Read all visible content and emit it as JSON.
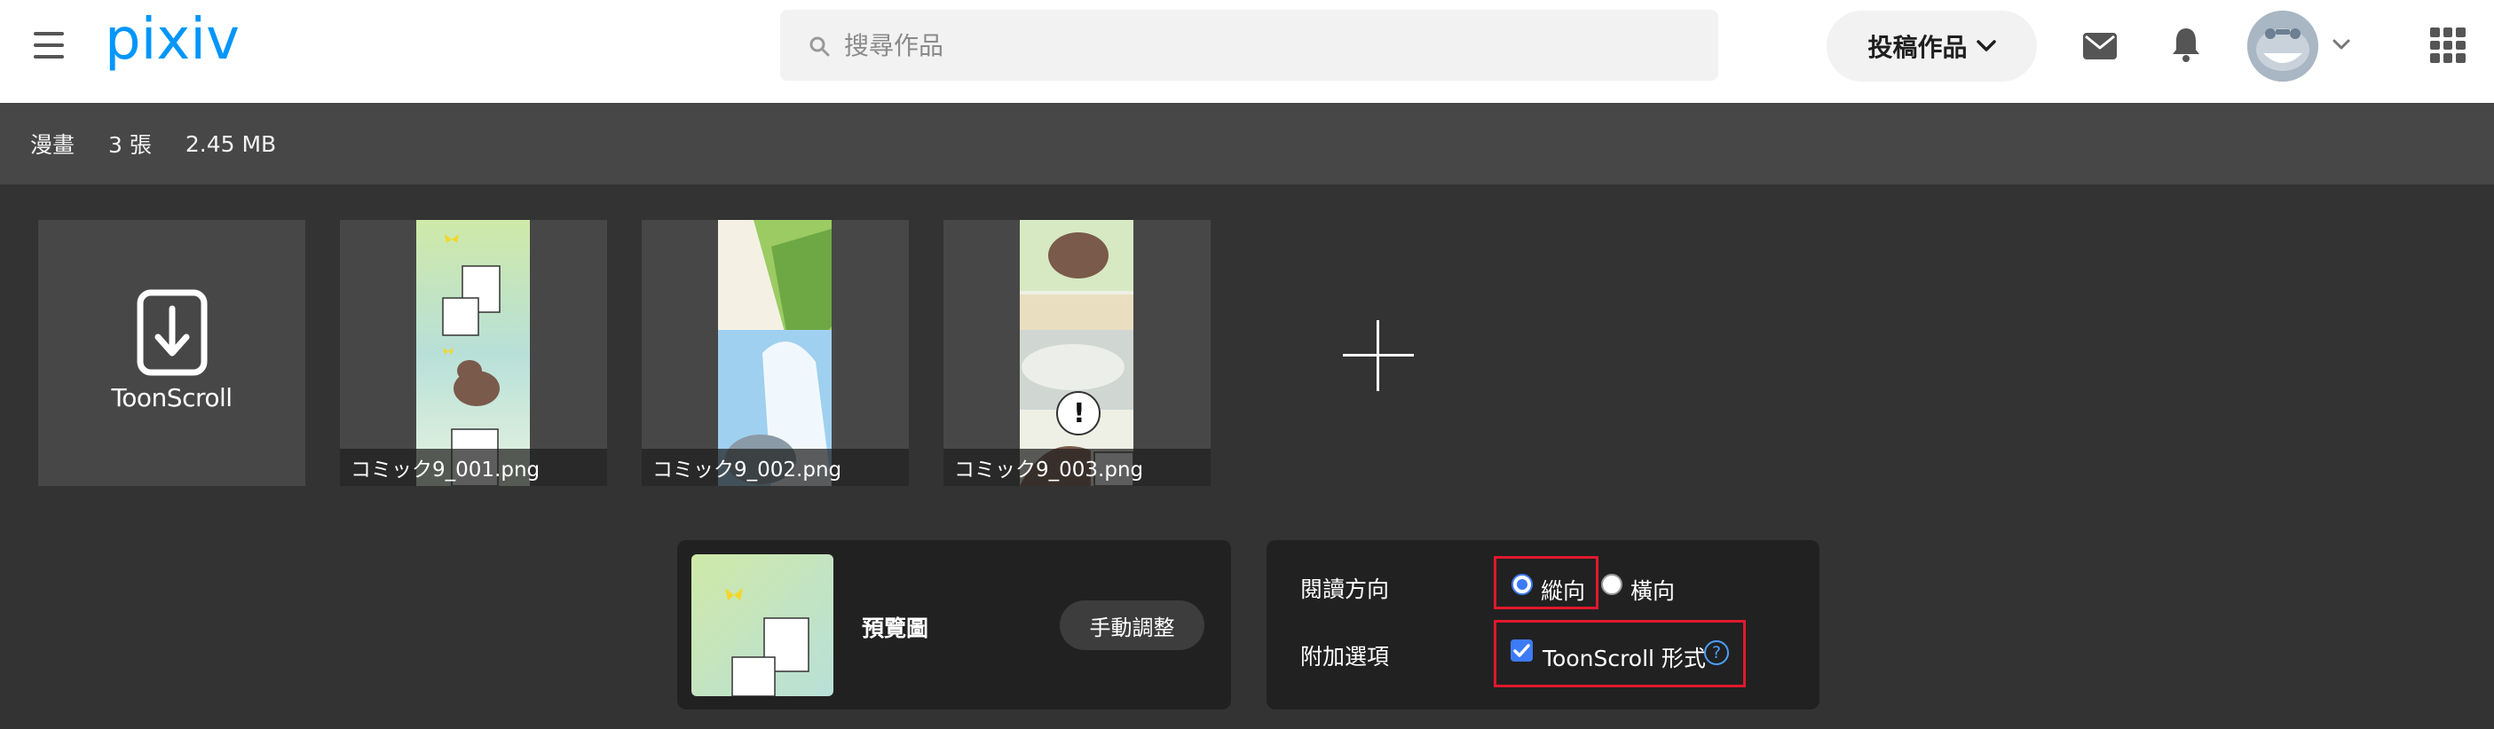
{
  "header": {
    "logo_text": "pixiv",
    "search": {
      "placeholder": "搜尋作品",
      "value": ""
    },
    "post_button_label": "投稿作品",
    "icons": {
      "menu": "hamburger-menu-icon",
      "mail": "mail-icon",
      "bell": "bell-icon",
      "apps": "apps-grid-icon"
    },
    "brand_color": "#0096fa"
  },
  "info_bar": {
    "type": "漫畫",
    "count": "3 張",
    "size": "2.45 MB"
  },
  "uploads": {
    "toonscroll_label": "ToonScroll",
    "files": [
      {
        "name": "コミック9_001.png"
      },
      {
        "name": "コミック9_002.png"
      },
      {
        "name": "コミック9_003.png"
      }
    ],
    "add_icon": "plus-icon"
  },
  "preview_panel": {
    "label": "預覽圖",
    "manual_button_label": "手動調整"
  },
  "settings_panel": {
    "reading_direction_label": "閱讀方向",
    "options": [
      {
        "label": "縱向",
        "selected": true
      },
      {
        "label": "橫向",
        "selected": false
      }
    ],
    "extra_label": "附加選項",
    "toonscroll_option": {
      "label": "ToonScroll 形式",
      "checked": true
    },
    "help_icon_text": "?",
    "accent_color": "#3d7bf6",
    "highlight_color": "#e0182d"
  }
}
